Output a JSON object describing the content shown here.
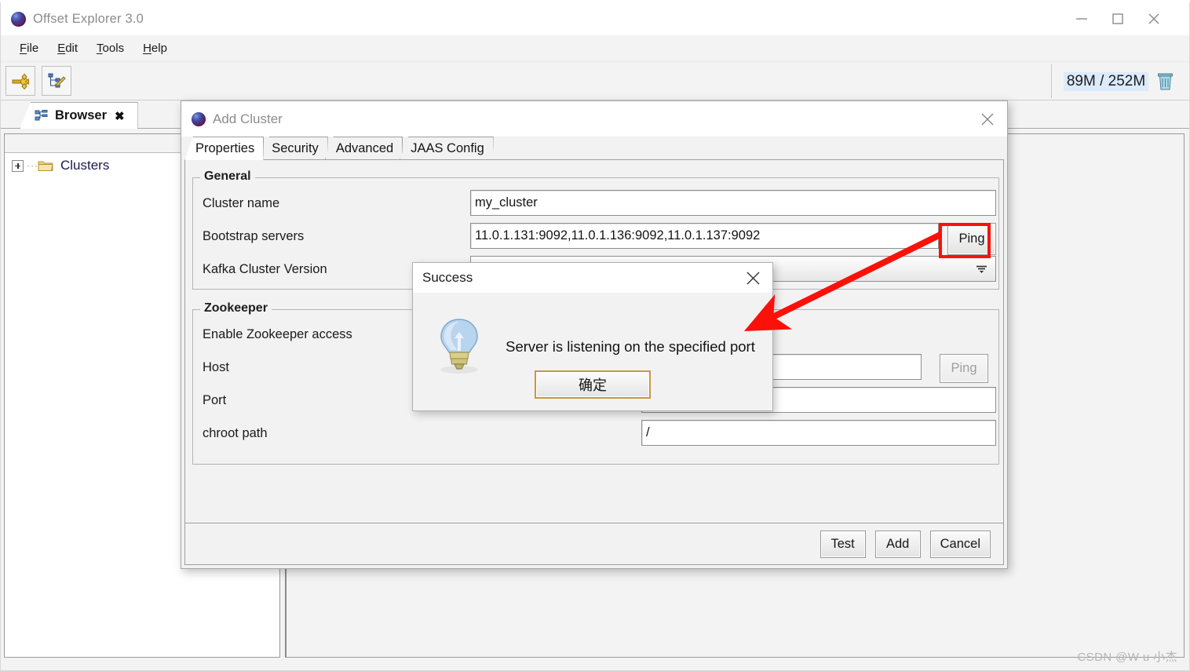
{
  "window": {
    "title": "Offset Explorer  3.0",
    "app_icon": "sphere-logo-icon",
    "controls": {
      "minimize": "minimize-icon",
      "maximize": "maximize-icon",
      "close": "close-icon"
    }
  },
  "menubar": {
    "items": [
      {
        "accel": "F",
        "rest": "ile"
      },
      {
        "accel": "E",
        "rest": "dit"
      },
      {
        "accel": "T",
        "rest": "ools"
      },
      {
        "accel": "H",
        "rest": "elp"
      }
    ]
  },
  "toolbar": {
    "buttons": [
      {
        "icon": "add-cluster-icon"
      },
      {
        "icon": "edit-tree-icon"
      }
    ],
    "memory": {
      "text": "89M / 252M",
      "icon": "trash-icon"
    }
  },
  "browser_tab": {
    "label": "Browser",
    "icon": "tree-view-icon",
    "close": "✖"
  },
  "tree": {
    "root": {
      "label": "Clusters",
      "icon": "folder-icon",
      "expander": "+"
    }
  },
  "dialog": {
    "title": "Add Cluster",
    "icon": "sphere-logo-icon",
    "close": "close-icon",
    "tabs": [
      {
        "label": "Properties",
        "active": true
      },
      {
        "label": "Security",
        "active": false
      },
      {
        "label": "Advanced",
        "active": false
      },
      {
        "label": "JAAS Config",
        "active": false
      }
    ],
    "general": {
      "legend": "General",
      "cluster_name": {
        "label": "Cluster name",
        "value": "my_cluster",
        "placeholder": ""
      },
      "bootstrap_servers": {
        "label": "Bootstrap servers",
        "value": "11.0.1.131:9092,11.0.1.136:9092,11.0.1.137:9092",
        "placeholder": "",
        "ping_label": "Ping"
      },
      "kafka_cluster_version": {
        "label": "Kafka Cluster Version",
        "value": ""
      }
    },
    "zookeeper": {
      "legend": "Zookeeper",
      "enable_label": "Enable Zookeeper access",
      "host": {
        "label": "Host",
        "value": "",
        "ping_label": "Ping"
      },
      "port": {
        "label": "Port",
        "value": ""
      },
      "chroot": {
        "label": "chroot path",
        "value": "/"
      }
    },
    "footer": {
      "test_label": "Test",
      "add_label": "Add",
      "cancel_label": "Cancel"
    }
  },
  "message_dialog": {
    "title": "Success",
    "close": "close-icon",
    "icon": "lightbulb-icon",
    "text": "Server is listening on the specified port",
    "ok_label": "确定"
  },
  "annotations": {
    "highlight_color": "#fb1109",
    "arrow": "red-arrow-icon",
    "box_target": "ping-button"
  },
  "watermark": {
    "text": "CSDN @W u 小杰"
  },
  "top_sliver": {
    "ghost_text": ""
  }
}
